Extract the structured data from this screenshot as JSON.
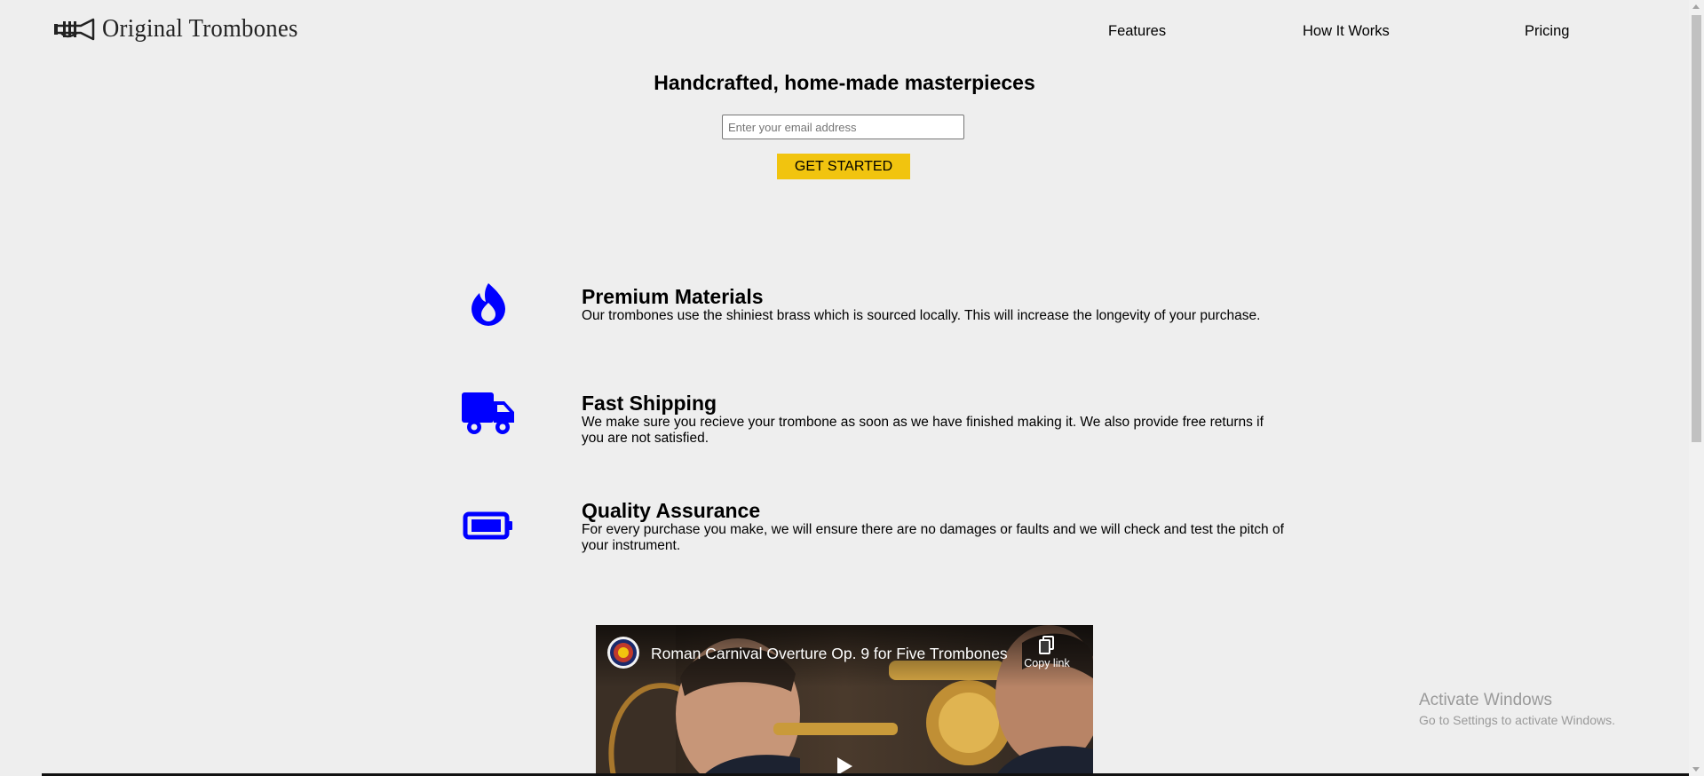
{
  "header": {
    "brand": "Original Trombones",
    "logo_icon": "trumpet-icon",
    "nav": [
      {
        "label": "Features"
      },
      {
        "label": "How It Works"
      },
      {
        "label": "Pricing"
      }
    ]
  },
  "hero": {
    "title": "Handcrafted, home-made masterpieces",
    "email_placeholder": "Enter your email address",
    "email_value": "",
    "cta_label": "GET STARTED",
    "cta_color": "#f1c40f"
  },
  "features": {
    "icon_color": "#0000ff",
    "items": [
      {
        "icon": "fire-icon",
        "title": "Premium Materials",
        "description": "Our trombones use the shiniest brass which is sourced locally. This will increase the longevity of your purchase."
      },
      {
        "icon": "truck-icon",
        "title": "Fast Shipping",
        "description": "We make sure you recieve your trombone as soon as we have finished making it. We also provide free returns if you are not satisfied."
      },
      {
        "icon": "battery-full-icon",
        "title": "Quality Assurance",
        "description": "For every purchase you make, we will ensure there are no damages or faults and we will check and test the pitch of your instrument."
      }
    ]
  },
  "video": {
    "title": "Roman Carnival Overture Op. 9 for Five Trombones",
    "copy_link_label": "Copy link",
    "copy_icon": "copy-icon",
    "play_icon": "play-icon",
    "channel_icon": "channel-avatar-icon"
  },
  "os_watermark": {
    "title": "Activate Windows",
    "subtitle": "Go to Settings to activate Windows."
  }
}
